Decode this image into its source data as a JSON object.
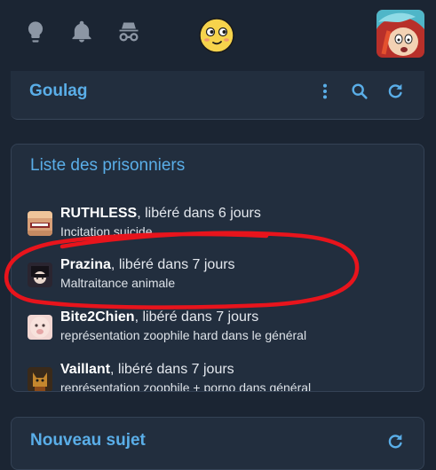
{
  "topbar": {
    "icons": [
      "lightbulb-icon",
      "bell-icon",
      "incognito-icon"
    ],
    "smiley": "smiley-emoji-icon"
  },
  "forum": {
    "title": "Goulag"
  },
  "prison": {
    "title": "Liste des prisonniers",
    "entries": [
      {
        "name": "RUTHLESS",
        "status": ", libéré dans 6 jours",
        "reason": "Incitation suicide"
      },
      {
        "name": "Prazina",
        "status": ", libéré dans 7 jours",
        "reason": "Maltraitance animale"
      },
      {
        "name": "Bite2Chien",
        "status": ", libéré dans 7 jours",
        "reason": "représentation zoophile hard dans le général"
      },
      {
        "name": "Vaillant",
        "status": ", libéré dans 7 jours",
        "reason": "représentation zoophile + porno dans général"
      }
    ]
  },
  "new_topic": {
    "title": "Nouveau sujet"
  },
  "colors": {
    "accent": "#5aaee8",
    "background": "#1b2533",
    "card": "#222e3e",
    "annotation": "#e8141c"
  }
}
